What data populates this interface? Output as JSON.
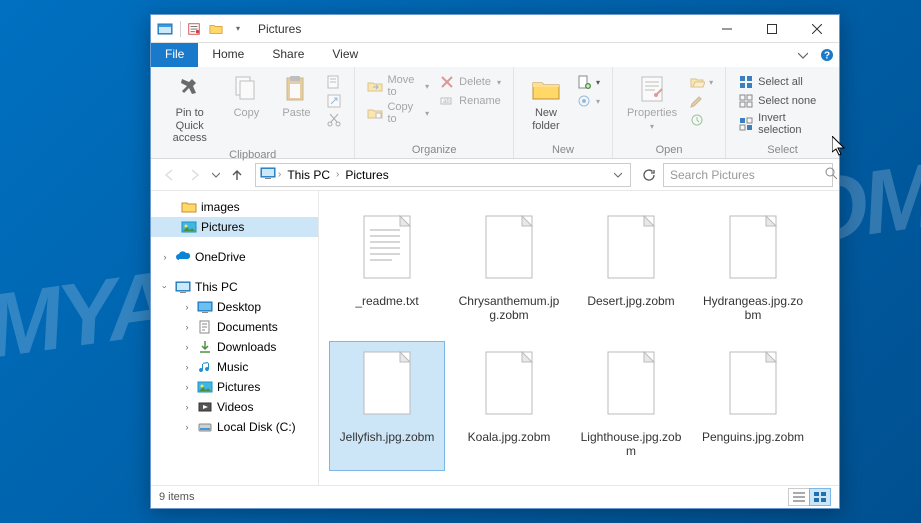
{
  "window": {
    "title": "Pictures"
  },
  "tabs": {
    "file": "File",
    "list": [
      "Home",
      "Share",
      "View"
    ]
  },
  "ribbon": {
    "clipboard": {
      "name": "Clipboard",
      "pin": "Pin to Quick\naccess",
      "copy": "Copy",
      "paste": "Paste"
    },
    "organize": {
      "name": "Organize",
      "moveto": "Move to",
      "copyto": "Copy to",
      "delete": "Delete",
      "rename": "Rename"
    },
    "new": {
      "name": "New",
      "newfolder": "New\nfolder"
    },
    "open": {
      "name": "Open",
      "properties": "Properties"
    },
    "select": {
      "name": "Select",
      "all": "Select all",
      "none": "Select none",
      "invert": "Invert selection"
    }
  },
  "breadcrumb": [
    "This PC",
    "Pictures"
  ],
  "search": {
    "placeholder": "Search Pictures"
  },
  "sidebar": {
    "quick": [
      {
        "label": "images",
        "icon": "folder"
      },
      {
        "label": "Pictures",
        "icon": "picture",
        "selected": true
      }
    ],
    "onedrive": {
      "label": "OneDrive"
    },
    "thispc": {
      "label": "This PC",
      "items": [
        {
          "label": "Desktop",
          "icon": "desktop"
        },
        {
          "label": "Documents",
          "icon": "documents"
        },
        {
          "label": "Downloads",
          "icon": "downloads"
        },
        {
          "label": "Music",
          "icon": "music"
        },
        {
          "label": "Pictures",
          "icon": "picture"
        },
        {
          "label": "Videos",
          "icon": "videos"
        },
        {
          "label": "Local Disk (C:)",
          "icon": "disk"
        }
      ]
    }
  },
  "files": [
    {
      "name": "_readme.txt",
      "type": "text",
      "selected": false
    },
    {
      "name": "Chrysanthemum.jpg.zobm",
      "type": "blank",
      "selected": false
    },
    {
      "name": "Desert.jpg.zobm",
      "type": "blank",
      "selected": false
    },
    {
      "name": "Hydrangeas.jpg.zobm",
      "type": "blank",
      "selected": false
    },
    {
      "name": "Jellyfish.jpg.zobm",
      "type": "blank",
      "selected": true
    },
    {
      "name": "Koala.jpg.zobm",
      "type": "blank",
      "selected": false
    },
    {
      "name": "Lighthouse.jpg.zobm",
      "type": "blank",
      "selected": false
    },
    {
      "name": "Penguins.jpg.zobm",
      "type": "blank",
      "selected": false
    }
  ],
  "status": {
    "count": "9 items"
  }
}
